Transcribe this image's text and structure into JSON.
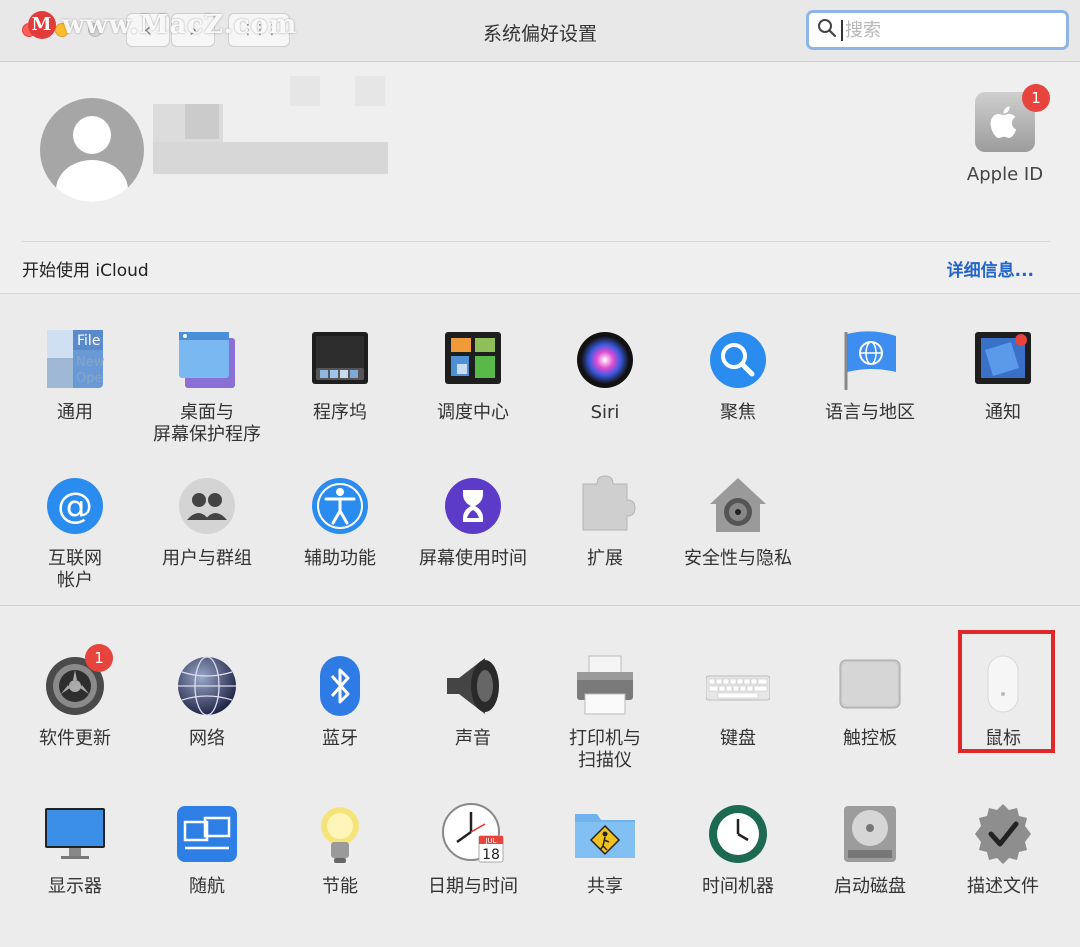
{
  "watermark": {
    "letter": "M",
    "text": "www.MacZ.com"
  },
  "window": {
    "title": "系统偏好设置"
  },
  "toolbar": {
    "back_glyph": "‹",
    "forward_glyph": "›",
    "grid_glyph": "⋮⋮⋮"
  },
  "search": {
    "placeholder": "搜索",
    "value": "",
    "icon": "search-icon"
  },
  "account": {
    "apple_id_label": "Apple ID",
    "apple_id_badge": "1",
    "icloud_prompt": "开始使用 iCloud",
    "details_link": "详细信息..."
  },
  "section1": [
    {
      "label": "通用",
      "icon": "general-icon"
    },
    {
      "label": "桌面与\n屏幕保护程序",
      "icon": "desktop-screensaver-icon"
    },
    {
      "label": "程序坞",
      "icon": "dock-icon"
    },
    {
      "label": "调度中心",
      "icon": "mission-control-icon"
    },
    {
      "label": "Siri",
      "icon": "siri-icon"
    },
    {
      "label": "聚焦",
      "icon": "spotlight-icon"
    },
    {
      "label": "语言与地区",
      "icon": "language-region-icon"
    },
    {
      "label": "通知",
      "icon": "notifications-icon"
    },
    {
      "label": "互联网\n帐户",
      "icon": "internet-accounts-icon"
    },
    {
      "label": "用户与群组",
      "icon": "users-groups-icon"
    },
    {
      "label": "辅助功能",
      "icon": "accessibility-icon"
    },
    {
      "label": "屏幕使用时间",
      "icon": "screen-time-icon"
    },
    {
      "label": "扩展",
      "icon": "extensions-icon"
    },
    {
      "label": "安全性与隐私",
      "icon": "security-privacy-icon"
    }
  ],
  "section2": [
    {
      "label": "软件更新",
      "icon": "software-update-icon",
      "badge": "1"
    },
    {
      "label": "网络",
      "icon": "network-icon"
    },
    {
      "label": "蓝牙",
      "icon": "bluetooth-icon"
    },
    {
      "label": "声音",
      "icon": "sound-icon"
    },
    {
      "label": "打印机与\n扫描仪",
      "icon": "printers-scanners-icon"
    },
    {
      "label": "键盘",
      "icon": "keyboard-icon"
    },
    {
      "label": "触控板",
      "icon": "trackpad-icon"
    },
    {
      "label": "鼠标",
      "icon": "mouse-icon"
    },
    {
      "label": "显示器",
      "icon": "displays-icon"
    },
    {
      "label": "随航",
      "icon": "sidecar-icon"
    },
    {
      "label": "节能",
      "icon": "energy-saver-icon"
    },
    {
      "label": "日期与时间",
      "icon": "date-time-icon"
    },
    {
      "label": "共享",
      "icon": "sharing-icon"
    },
    {
      "label": "时间机器",
      "icon": "time-machine-icon"
    },
    {
      "label": "启动磁盘",
      "icon": "startup-disk-icon"
    },
    {
      "label": "描述文件",
      "icon": "profiles-icon"
    }
  ],
  "calendar_icon_text": {
    "month": "JUL",
    "day": "18"
  },
  "colors": {
    "accent": "#2264c8",
    "badge": "#e6443d",
    "highlight": "#e0282b"
  }
}
